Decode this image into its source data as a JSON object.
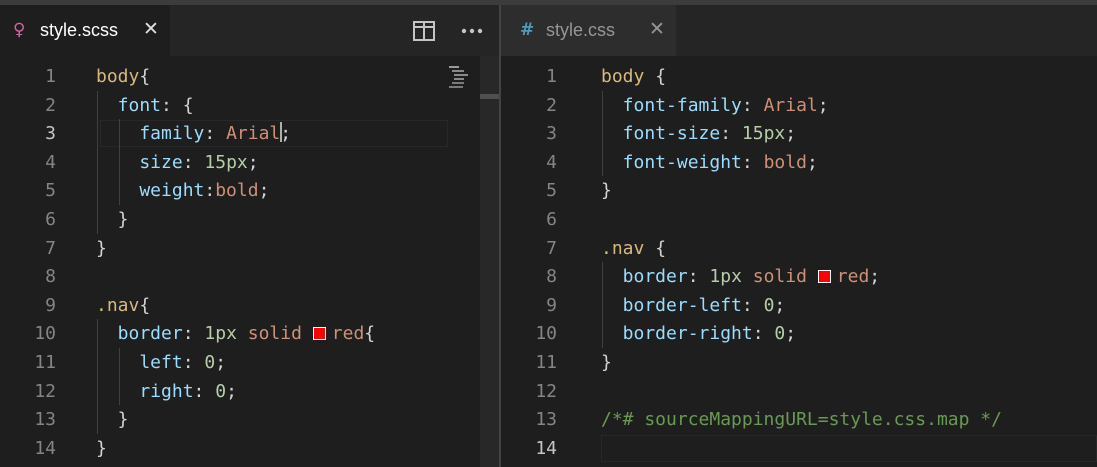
{
  "editor_left": {
    "tab": {
      "label": "style.scss",
      "icon": "sass-file-icon",
      "icon_color": "#cd6799",
      "close": "✕"
    },
    "actions": [
      "split-editor-icon",
      "more-actions-icon"
    ],
    "current_line": 3,
    "lines": [
      {
        "n": "1",
        "tokens": [
          {
            "t": "body",
            "c": "tk-sel"
          },
          {
            "t": "{",
            "c": "tk-pun"
          }
        ]
      },
      {
        "n": "2",
        "tokens": [
          {
            "t": "  font",
            "c": "tk-prop"
          },
          {
            "t": ": {",
            "c": "tk-pun"
          }
        ]
      },
      {
        "n": "3",
        "tokens": [
          {
            "t": "    family",
            "c": "tk-prop"
          },
          {
            "t": ": ",
            "c": "tk-pun"
          },
          {
            "t": "Arial",
            "c": "tk-val",
            "cursor_after": true
          },
          {
            "t": ";",
            "c": "tk-pun"
          }
        ]
      },
      {
        "n": "4",
        "tokens": [
          {
            "t": "    size",
            "c": "tk-prop"
          },
          {
            "t": ": ",
            "c": "tk-pun"
          },
          {
            "t": "15px",
            "c": "tk-num"
          },
          {
            "t": ";",
            "c": "tk-pun"
          }
        ]
      },
      {
        "n": "5",
        "tokens": [
          {
            "t": "    weight",
            "c": "tk-prop"
          },
          {
            "t": ":",
            "c": "tk-pun"
          },
          {
            "t": "bold",
            "c": "tk-val"
          },
          {
            "t": ";",
            "c": "tk-pun"
          }
        ]
      },
      {
        "n": "6",
        "tokens": [
          {
            "t": "  }",
            "c": "tk-pun"
          }
        ]
      },
      {
        "n": "7",
        "tokens": [
          {
            "t": "}",
            "c": "tk-pun"
          }
        ]
      },
      {
        "n": "8",
        "tokens": []
      },
      {
        "n": "9",
        "tokens": [
          {
            "t": ".nav",
            "c": "tk-sel"
          },
          {
            "t": "{",
            "c": "tk-pun"
          }
        ]
      },
      {
        "n": "10",
        "tokens": [
          {
            "t": "  border",
            "c": "tk-prop"
          },
          {
            "t": ": ",
            "c": "tk-pun"
          },
          {
            "t": "1px",
            "c": "tk-num"
          },
          {
            "t": " ",
            "c": "tk-pun"
          },
          {
            "t": "solid",
            "c": "tk-val"
          },
          {
            "t": " ",
            "c": "tk-pun"
          },
          {
            "swatch": "#ff0000"
          },
          {
            "t": "red",
            "c": "tk-val"
          },
          {
            "t": "{",
            "c": "tk-pun"
          }
        ]
      },
      {
        "n": "11",
        "tokens": [
          {
            "t": "    left",
            "c": "tk-prop"
          },
          {
            "t": ": ",
            "c": "tk-pun"
          },
          {
            "t": "0",
            "c": "tk-num"
          },
          {
            "t": ";",
            "c": "tk-pun"
          }
        ]
      },
      {
        "n": "12",
        "tokens": [
          {
            "t": "    right",
            "c": "tk-prop"
          },
          {
            "t": ": ",
            "c": "tk-pun"
          },
          {
            "t": "0",
            "c": "tk-num"
          },
          {
            "t": ";",
            "c": "tk-pun"
          }
        ]
      },
      {
        "n": "13",
        "tokens": [
          {
            "t": "  }",
            "c": "tk-pun"
          }
        ]
      },
      {
        "n": "14",
        "tokens": [
          {
            "t": "}",
            "c": "tk-pun"
          }
        ]
      }
    ]
  },
  "editor_right": {
    "tab": {
      "label": "style.css",
      "icon_text": "#",
      "icon": "css-file-icon",
      "icon_color": "#519aba",
      "close": "✕"
    },
    "current_line": 14,
    "lines": [
      {
        "n": "1",
        "tokens": [
          {
            "t": "body",
            "c": "tk-sel"
          },
          {
            "t": " {",
            "c": "tk-pun"
          }
        ]
      },
      {
        "n": "2",
        "tokens": [
          {
            "t": "  font-family",
            "c": "tk-prop"
          },
          {
            "t": ": ",
            "c": "tk-pun"
          },
          {
            "t": "Arial",
            "c": "tk-val"
          },
          {
            "t": ";",
            "c": "tk-pun"
          }
        ]
      },
      {
        "n": "3",
        "tokens": [
          {
            "t": "  font-size",
            "c": "tk-prop"
          },
          {
            "t": ": ",
            "c": "tk-pun"
          },
          {
            "t": "15px",
            "c": "tk-num"
          },
          {
            "t": ";",
            "c": "tk-pun"
          }
        ]
      },
      {
        "n": "4",
        "tokens": [
          {
            "t": "  font-weight",
            "c": "tk-prop"
          },
          {
            "t": ": ",
            "c": "tk-pun"
          },
          {
            "t": "bold",
            "c": "tk-val"
          },
          {
            "t": ";",
            "c": "tk-pun"
          }
        ]
      },
      {
        "n": "5",
        "tokens": [
          {
            "t": "}",
            "c": "tk-pun"
          }
        ]
      },
      {
        "n": "6",
        "tokens": []
      },
      {
        "n": "7",
        "tokens": [
          {
            "t": ".nav",
            "c": "tk-sel"
          },
          {
            "t": " {",
            "c": "tk-pun"
          }
        ]
      },
      {
        "n": "8",
        "tokens": [
          {
            "t": "  border",
            "c": "tk-prop"
          },
          {
            "t": ": ",
            "c": "tk-pun"
          },
          {
            "t": "1px",
            "c": "tk-num"
          },
          {
            "t": " ",
            "c": "tk-pun"
          },
          {
            "t": "solid",
            "c": "tk-val"
          },
          {
            "t": " ",
            "c": "tk-pun"
          },
          {
            "swatch": "#ff0000"
          },
          {
            "t": "red",
            "c": "tk-val"
          },
          {
            "t": ";",
            "c": "tk-pun"
          }
        ]
      },
      {
        "n": "9",
        "tokens": [
          {
            "t": "  border-left",
            "c": "tk-prop"
          },
          {
            "t": ": ",
            "c": "tk-pun"
          },
          {
            "t": "0",
            "c": "tk-num"
          },
          {
            "t": ";",
            "c": "tk-pun"
          }
        ]
      },
      {
        "n": "10",
        "tokens": [
          {
            "t": "  border-right",
            "c": "tk-prop"
          },
          {
            "t": ": ",
            "c": "tk-pun"
          },
          {
            "t": "0",
            "c": "tk-num"
          },
          {
            "t": ";",
            "c": "tk-pun"
          }
        ]
      },
      {
        "n": "11",
        "tokens": [
          {
            "t": "}",
            "c": "tk-pun"
          }
        ]
      },
      {
        "n": "12",
        "tokens": []
      },
      {
        "n": "13",
        "tokens": [
          {
            "t": "/*# sourceMappingURL=style.css.map */",
            "c": "tk-com"
          }
        ]
      },
      {
        "n": "14",
        "tokens": []
      }
    ]
  },
  "colors": {
    "editor_bg": "#1e1e1e",
    "tab_active_bg": "#1e1e1e",
    "tab_inactive_bg": "#2d2d2d",
    "tabbar_bg": "#252526"
  }
}
